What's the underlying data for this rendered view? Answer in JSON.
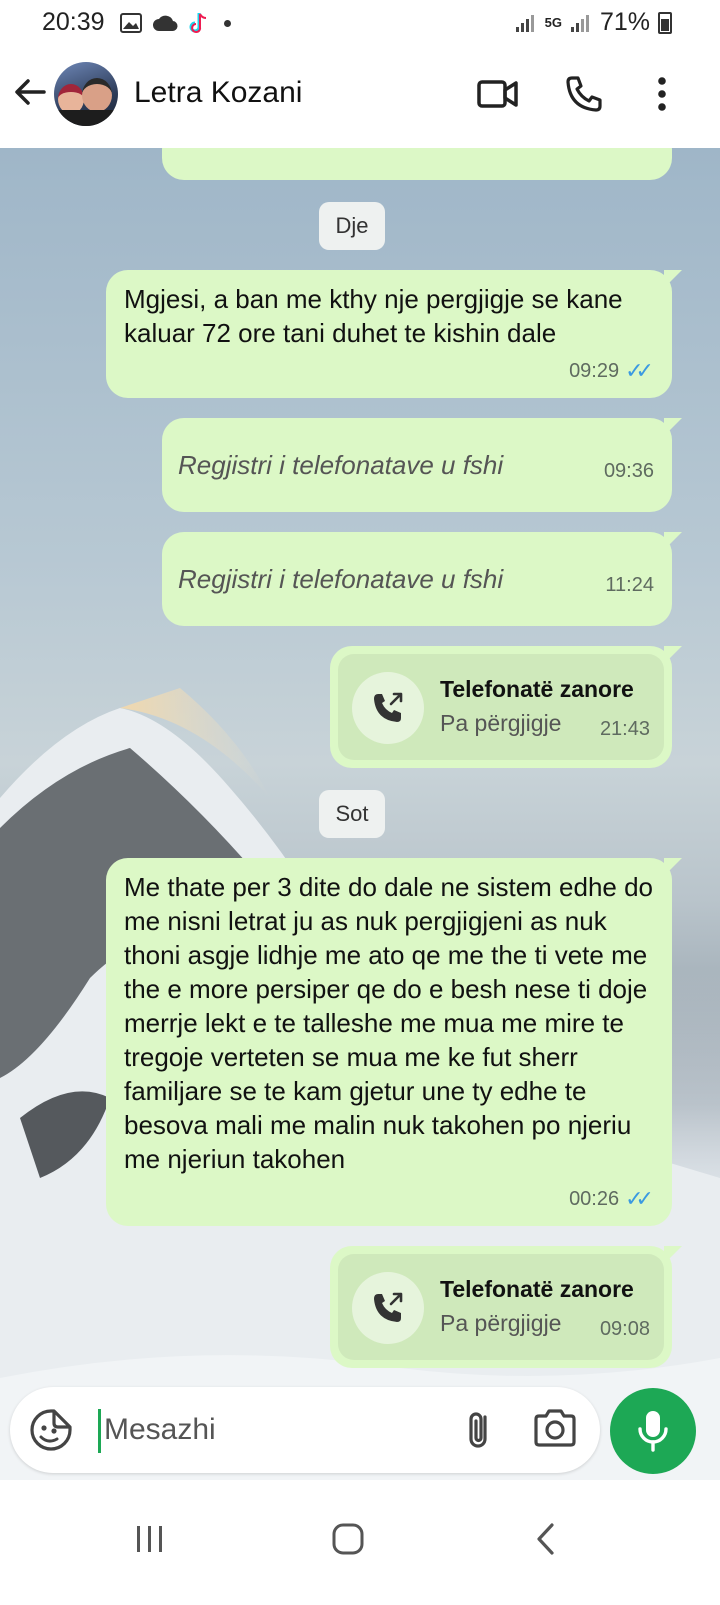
{
  "status_bar": {
    "time": "20:39",
    "network": "5G",
    "battery": "71%"
  },
  "header": {
    "contact_name": "Letra Kozani"
  },
  "chat": {
    "date_yesterday": "Dje",
    "date_today": "Sot",
    "messages": [
      {
        "type": "text",
        "text": "Mgjesi, a ban me kthy nje pergjigje se kane kaluar 72 ore tani duhet te kishin dale",
        "time": "09:29",
        "read": true
      },
      {
        "type": "deleted",
        "text": "Regjistri i telefonatave u fshi",
        "time": "09:36"
      },
      {
        "type": "deleted",
        "text": "Regjistri i telefonatave u fshi",
        "time": "11:24"
      },
      {
        "type": "call",
        "title": "Telefonatë zanore",
        "status": "Pa përgjigje",
        "time": "21:43"
      },
      {
        "type": "text",
        "text": "Me thate per 3 dite do dale ne sistem edhe do me nisni letrat  ju as nuk pergjigjeni as nuk thoni asgje lidhje me ato qe me the ti vete me the e more persiper qe do e besh nese ti doje merrje lekt e te talleshe me mua me mire te tregoje verteten se mua me ke fut sherr familjare se te kam gjetur une ty edhe te besova mali me malin nuk takohen po njeriu me njeriun takohen",
        "time": "00:26",
        "read": true
      },
      {
        "type": "call",
        "title": "Telefonatë zanore",
        "status": "Pa përgjigje",
        "time": "09:08"
      }
    ]
  },
  "composer": {
    "placeholder": "Mesazhi"
  },
  "colors": {
    "bubble_out": "#dcf8c6",
    "accent": "#1da855",
    "read_ticks": "#3b9ae1"
  },
  "icons": [
    "back-arrow-icon",
    "video-call-icon",
    "phone-icon",
    "more-icon",
    "emoji-icon",
    "paperclip-icon",
    "camera-icon",
    "mic-icon",
    "missed-call-icon"
  ]
}
